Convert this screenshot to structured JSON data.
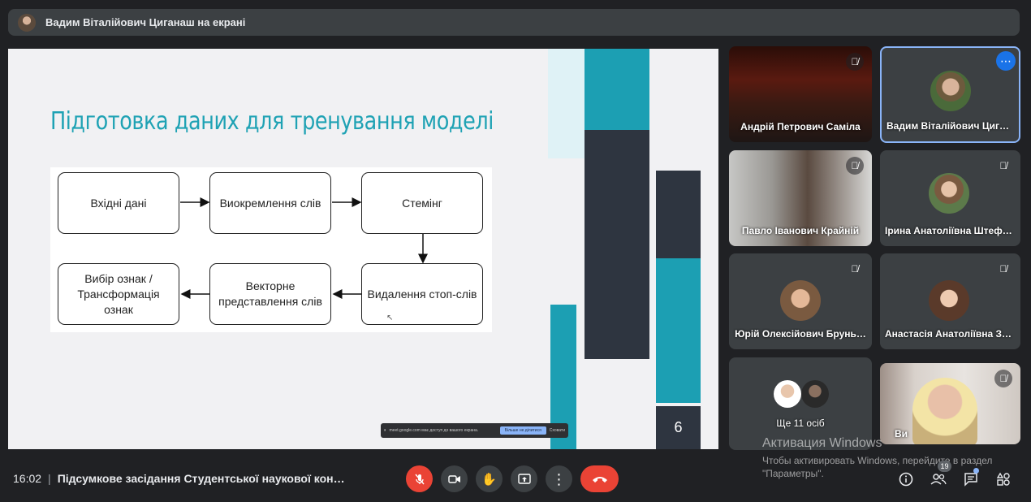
{
  "header": {
    "presenter_title": "Вадим Віталійович Циганаш на екрані"
  },
  "slide": {
    "title": "Підготовка даних для тренування моделі",
    "nodes": {
      "n1": "Вхідні дані",
      "n2": "Виокремлення слів",
      "n3": "Стемінг",
      "n4": "Видалення стоп-слів",
      "n5": "Векторне представлення слів",
      "n6": "Вибір ознак / Трансформація ознак"
    },
    "page_number": "6",
    "share_notice": {
      "text": "meet.google.com має доступ до вашого екрана.",
      "stop_label": "Більше не ділитися",
      "hide_label": "Сховати"
    }
  },
  "participants": [
    {
      "name": "Андрій Петрович Саміла",
      "muted": true
    },
    {
      "name": "Вадим Віталійович Циган…",
      "muted": false
    },
    {
      "name": "Павло Іванович Крайній",
      "muted": true
    },
    {
      "name": "Ірина Анатоліївна Штефа…",
      "muted": true
    },
    {
      "name": "Юрій Олексійович Брунь…",
      "muted": true
    },
    {
      "name": "Анастасія Анатоліївна За…",
      "muted": true
    },
    {
      "name": "Ще 11 осіб",
      "muted": false
    },
    {
      "name": "Ви",
      "muted": true
    }
  ],
  "bottom": {
    "time": "16:02",
    "meeting_title": "Підсумкове засідання Студентської наукової кон…",
    "participants_count": "19"
  },
  "watermark": {
    "title": "Активация Windows",
    "subtitle": "Чтобы активировать Windows, перейдите в раздел \"Параметры\"."
  },
  "colors": {
    "accent": "#1fa2b4",
    "danger": "#ea4335",
    "bg": "#202124",
    "tile": "#3c4043"
  }
}
